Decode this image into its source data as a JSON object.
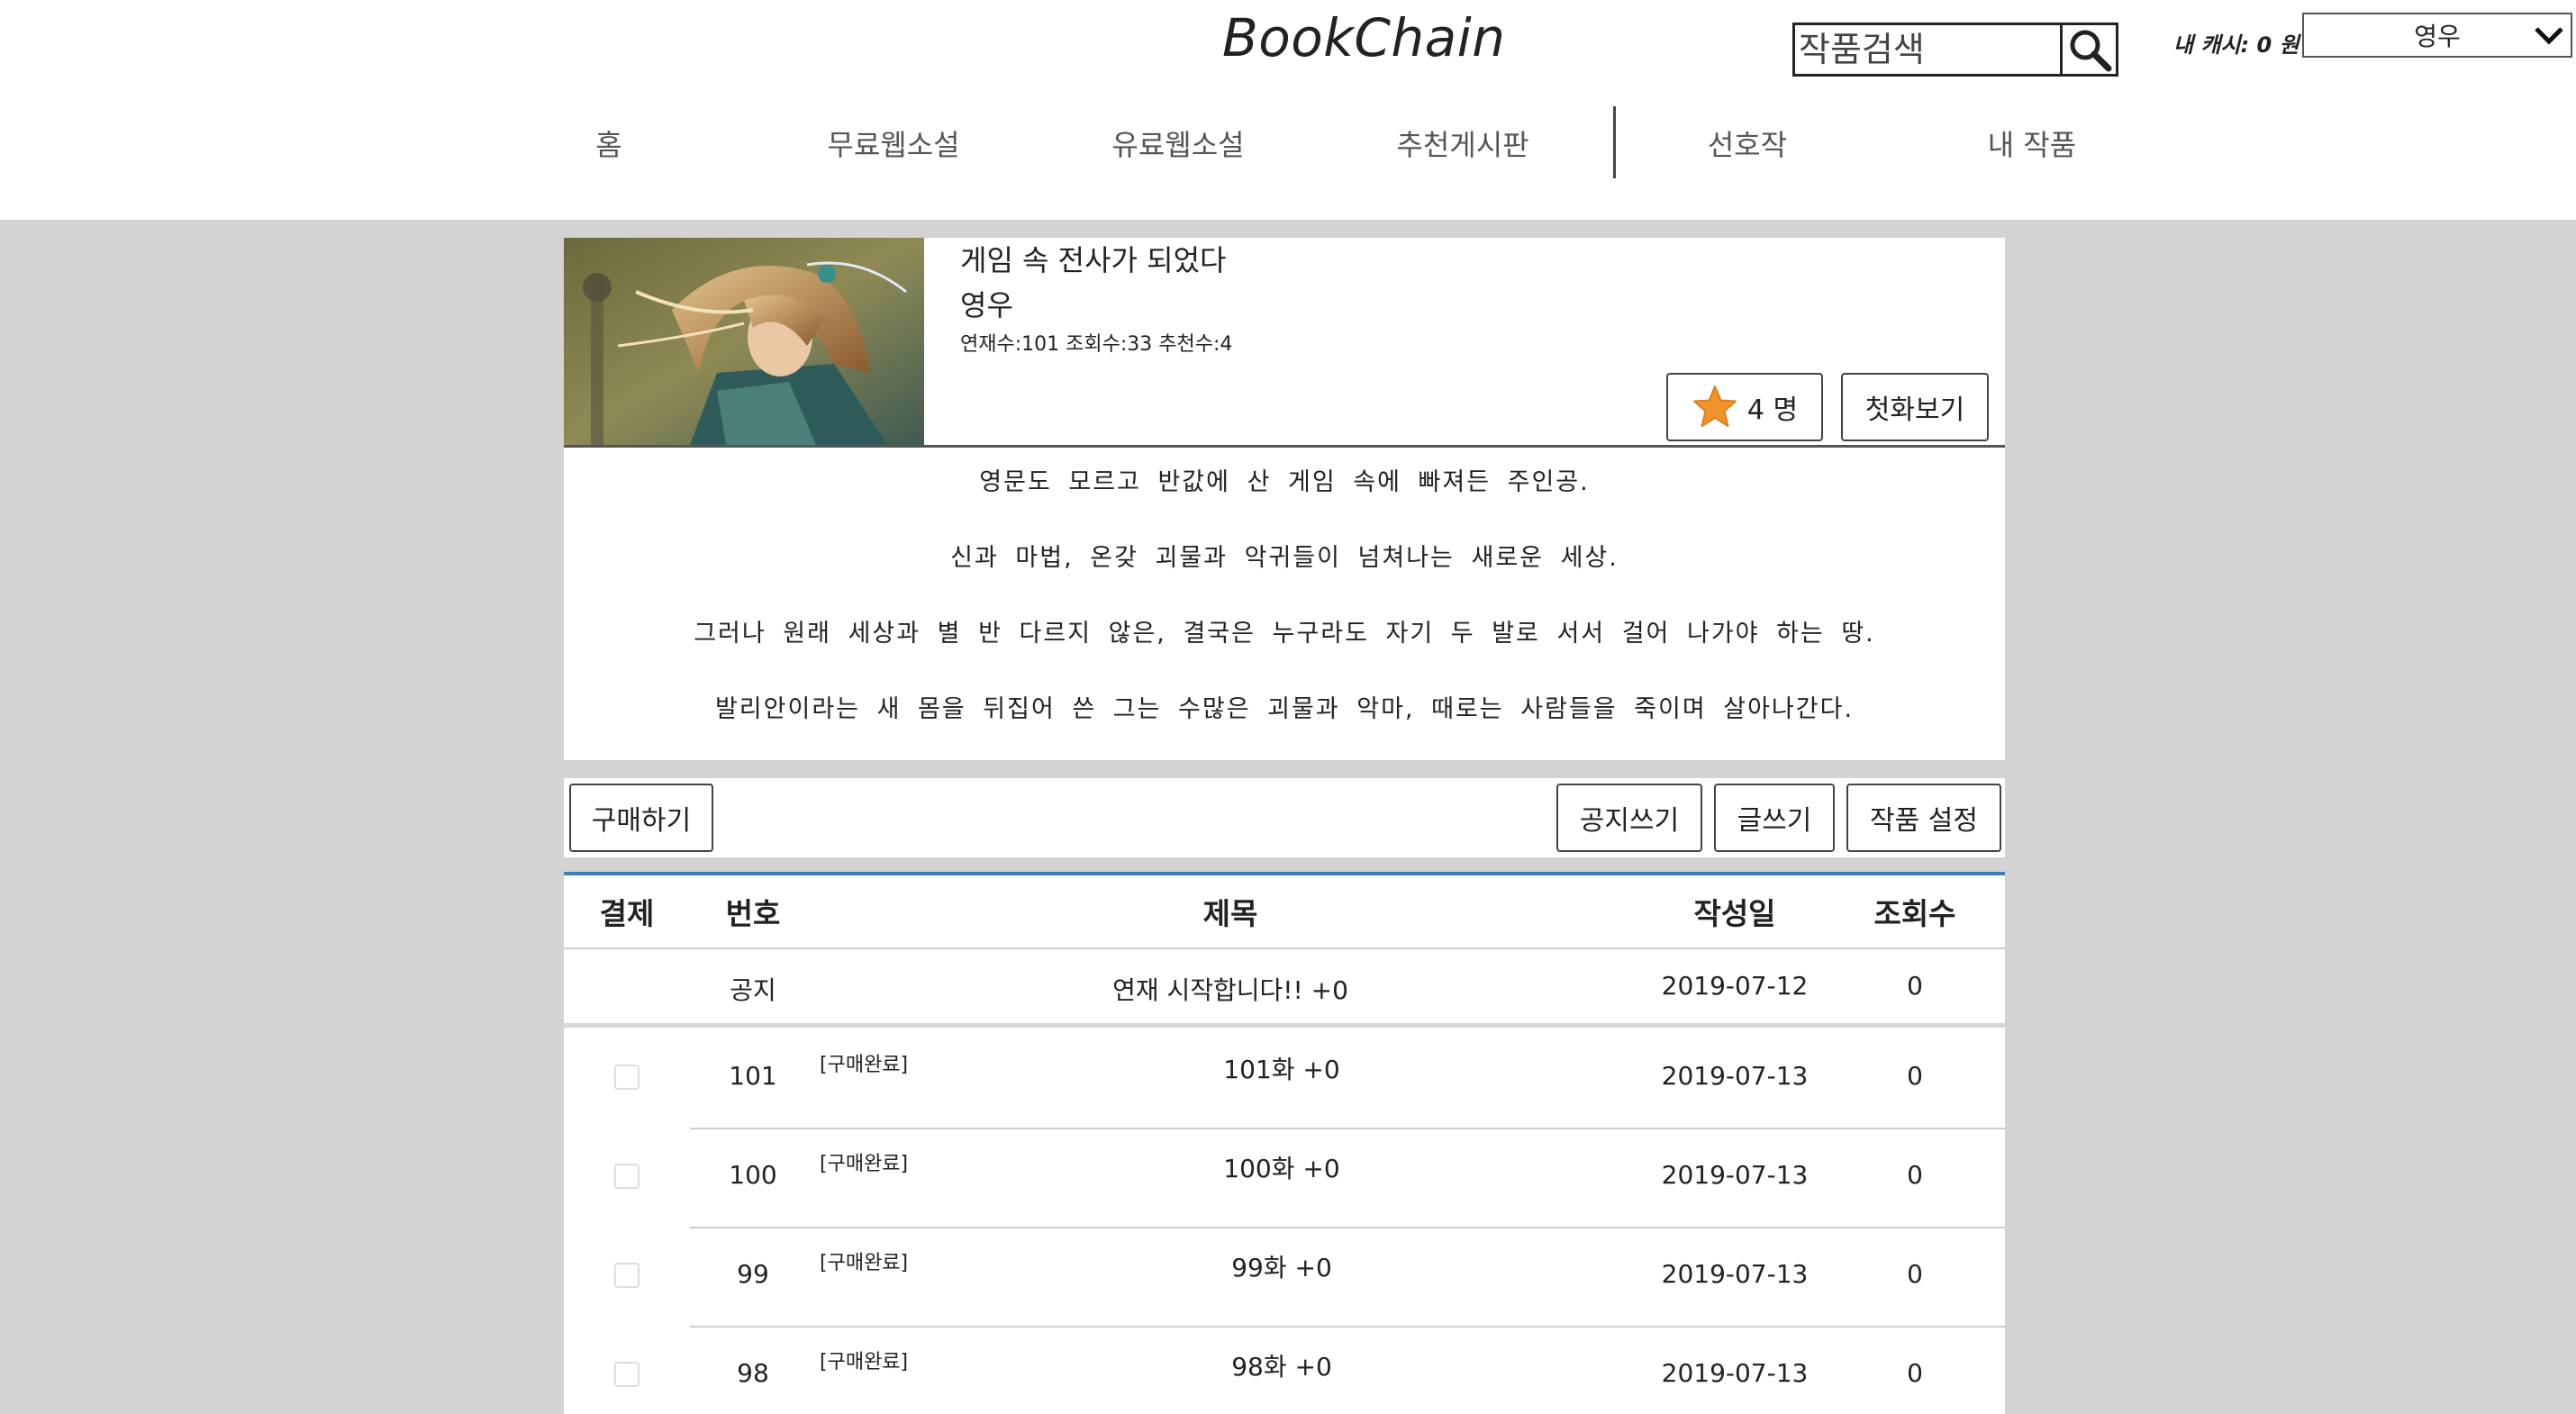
{
  "header": {
    "logo": "BookChain",
    "search": {
      "placeholder": "작품검색",
      "icon": "search-icon"
    },
    "cash": "내 캐시: 0 원",
    "user": {
      "selected": "영우",
      "icon": "chevron-down-icon"
    },
    "nav": [
      {
        "label": "홈"
      },
      {
        "label": "무료웹소설"
      },
      {
        "label": "유료웹소설"
      },
      {
        "label": "추천게시판"
      },
      {
        "label": "선호작"
      },
      {
        "label": "내 작품"
      }
    ]
  },
  "book": {
    "title": "게임 속 전사가 되었다",
    "author": "영우",
    "stats": "연재수:101 조회수:33 추천수:4",
    "recommend_label": "4 명",
    "recommend_icon": "star-icon",
    "first_episode_label": "첫화보기",
    "synopsis": [
      "영문도 모르고 반값에 산 게임 속에 빠져든 주인공.",
      "신과 마법, 온갖 괴물과 악귀들이 넘쳐나는 새로운 세상.",
      "그러나 원래 세상과 별 반 다르지 않은, 결국은 누구라도 자기 두 발로 서서 걸어 나가야 하는 땅.",
      "발리안이라는 새 몸을 뒤집어 쓴 그는 수많은 괴물과 악마, 때로는 사람들을 죽이며 살아나간다."
    ]
  },
  "actions": {
    "buy": "구매하기",
    "notice": "공지쓰기",
    "write": "글쓰기",
    "settings": "작품 설정"
  },
  "table": {
    "headers": {
      "pay": "결제",
      "no": "번호",
      "title": "제목",
      "date": "작성일",
      "views": "조회수"
    },
    "notice": {
      "no": "공지",
      "title": "연재 시작합니다!! +0",
      "date": "2019-07-12",
      "views": "0"
    },
    "rows": [
      {
        "no": "101",
        "tag": "[구매완료]",
        "title": "101화 +0",
        "date": "2019-07-13",
        "views": "0"
      },
      {
        "no": "100",
        "tag": "[구매완료]",
        "title": "100화 +0",
        "date": "2019-07-13",
        "views": "0"
      },
      {
        "no": "99",
        "tag": "[구매완료]",
        "title": "99화 +0",
        "date": "2019-07-13",
        "views": "0"
      },
      {
        "no": "98",
        "tag": "[구매완료]",
        "title": "98화 +0",
        "date": "2019-07-13",
        "views": "0"
      }
    ]
  },
  "colors": {
    "accent": "#3d7eb6",
    "star": "#f0932b",
    "background": "#d3d3d3"
  }
}
